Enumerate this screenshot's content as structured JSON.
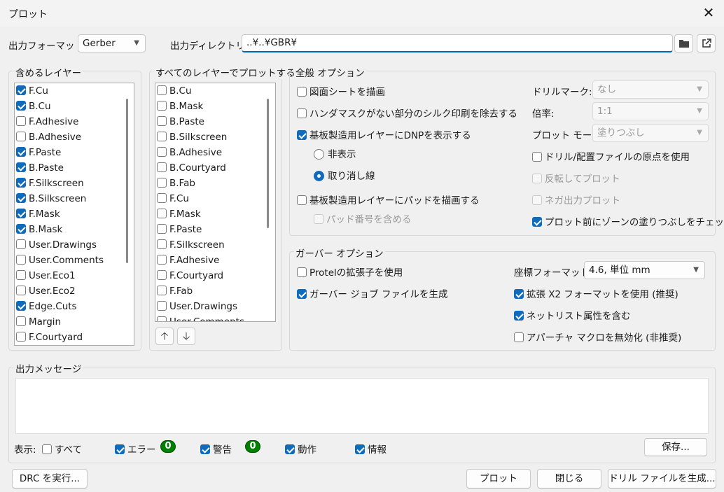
{
  "window": {
    "title": "プロット",
    "close_glyph": "✕"
  },
  "output_format": {
    "label": "出力フォーマット:",
    "value": "Gerber"
  },
  "output_dir": {
    "label": "出力ディレクトリ:",
    "value": "..¥..¥GBR¥"
  },
  "include_layers": {
    "title": "含めるレイヤー",
    "items": [
      {
        "label": "F.Cu",
        "checked": true
      },
      {
        "label": "B.Cu",
        "checked": true
      },
      {
        "label": "F.Adhesive",
        "checked": false
      },
      {
        "label": "B.Adhesive",
        "checked": false
      },
      {
        "label": "F.Paste",
        "checked": true
      },
      {
        "label": "B.Paste",
        "checked": true
      },
      {
        "label": "F.Silkscreen",
        "checked": true
      },
      {
        "label": "B.Silkscreen",
        "checked": true
      },
      {
        "label": "F.Mask",
        "checked": true
      },
      {
        "label": "B.Mask",
        "checked": true
      },
      {
        "label": "User.Drawings",
        "checked": false
      },
      {
        "label": "User.Comments",
        "checked": false
      },
      {
        "label": "User.Eco1",
        "checked": false
      },
      {
        "label": "User.Eco2",
        "checked": false
      },
      {
        "label": "Edge.Cuts",
        "checked": true
      },
      {
        "label": "Margin",
        "checked": false
      },
      {
        "label": "F.Courtyard",
        "checked": false
      }
    ]
  },
  "all_layers": {
    "title": "すべてのレイヤーでプロットする",
    "items": [
      {
        "label": "B.Cu",
        "checked": false
      },
      {
        "label": "B.Mask",
        "checked": false
      },
      {
        "label": "B.Paste",
        "checked": false
      },
      {
        "label": "B.Silkscreen",
        "checked": false
      },
      {
        "label": "B.Adhesive",
        "checked": false
      },
      {
        "label": "B.Courtyard",
        "checked": false
      },
      {
        "label": "B.Fab",
        "checked": false
      },
      {
        "label": "F.Cu",
        "checked": false
      },
      {
        "label": "F.Mask",
        "checked": false
      },
      {
        "label": "F.Paste",
        "checked": false
      },
      {
        "label": "F.Silkscreen",
        "checked": false
      },
      {
        "label": "F.Adhesive",
        "checked": false
      },
      {
        "label": "F.Courtyard",
        "checked": false
      },
      {
        "label": "F.Fab",
        "checked": false
      },
      {
        "label": "User.Drawings",
        "checked": false
      },
      {
        "label": "User.Comments",
        "checked": false
      }
    ],
    "up_glyph": "🡡",
    "down_glyph": "🡣"
  },
  "general": {
    "title": "全般 オプション",
    "draw_sheet": {
      "label": "図面シートを描画",
      "checked": false
    },
    "remove_silk": {
      "label": "ハンダマスクがない部分のシルク印刷を除去する",
      "checked": false
    },
    "show_dnp": {
      "label": "基板製造用レイヤーにDNPを表示する",
      "checked": true
    },
    "radio_hide": {
      "label": "非表示",
      "selected": false
    },
    "radio_strike": {
      "label": "取り消し線",
      "selected": true
    },
    "draw_pads": {
      "label": "基板製造用レイヤーにパッドを描画する",
      "checked": false
    },
    "pad_numbers": {
      "label": "パッド番号を含める",
      "checked": false,
      "disabled": true
    },
    "drill_marks": {
      "label": "ドリルマーク:",
      "value": "なし"
    },
    "scale": {
      "label": "倍率:",
      "value": "1:1"
    },
    "plot_mode": {
      "label": "プロット モード:",
      "value": "塗りつぶし"
    },
    "use_drill_origin": {
      "label": "ドリル/配置ファイルの原点を使用",
      "checked": false
    },
    "mirror": {
      "label": "反転してプロット",
      "checked": false,
      "disabled": true
    },
    "negative": {
      "label": "ネガ出力プロット",
      "checked": false,
      "disabled": true
    },
    "check_zones": {
      "label": "プロット前にゾーンの塗りつぶしをチェック",
      "checked": true
    }
  },
  "gerber": {
    "title": "ガーバー オプション",
    "protel_ext": {
      "label": "Protelの拡張子を使用",
      "checked": false
    },
    "job_file": {
      "label": "ガーバー ジョブ ファイルを生成",
      "checked": true
    },
    "coord_format": {
      "label": "座標フォーマット:",
      "value": "4.6, 単位 mm"
    },
    "x2": {
      "label": "拡張 X2 フォーマットを使用 (推奨)",
      "checked": true
    },
    "netlist": {
      "label": "ネットリスト属性を含む",
      "checked": true
    },
    "no_macros": {
      "label": "アパーチャ マクロを無効化 (非推奨)",
      "checked": false
    }
  },
  "messages": {
    "title": "出力メッセージ",
    "show_label": "表示:",
    "filter_all": {
      "label": "すべて",
      "checked": false
    },
    "filter_errors": {
      "label": "エラー",
      "checked": true,
      "count": "0"
    },
    "filter_warnings": {
      "label": "警告",
      "checked": true,
      "count": "0"
    },
    "filter_actions": {
      "label": "動作",
      "checked": true
    },
    "filter_info": {
      "label": "情報",
      "checked": true
    },
    "save_label": "保存..."
  },
  "footer": {
    "drc_label": "DRC を実行...",
    "plot_label": "プロット",
    "close_label": "閉じる",
    "drill_label": "ドリル ファイルを生成..."
  },
  "colors": {
    "accent": "#0f6cbd",
    "badge": "#008000",
    "background": "#f0f0f0"
  }
}
